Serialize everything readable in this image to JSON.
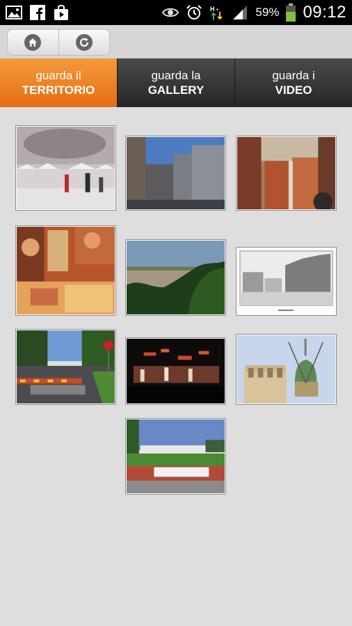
{
  "status_bar": {
    "battery_percent": "59%",
    "time": "09:12",
    "left_icons": [
      "gallery-icon",
      "facebook-icon",
      "shopping-bag-icon"
    ],
    "right_icons": [
      "eye-icon",
      "alarm-icon",
      "data-transfer-icon",
      "signal-icon",
      "battery-icon"
    ]
  },
  "nav": {
    "buttons": [
      "home-icon",
      "refresh-icon"
    ]
  },
  "tabs": [
    {
      "line1": "guarda il",
      "line2": "TERRITORIO",
      "active": true
    },
    {
      "line1": "guarda la",
      "line2": "GALLERY",
      "active": false
    },
    {
      "line1": "guarda i",
      "line2": "VIDEO",
      "active": false
    }
  ],
  "gallery": {
    "photos": [
      {
        "subject": "foggy square ice rink"
      },
      {
        "subject": "street buildings blue sky"
      },
      {
        "subject": "aerial town rooftops"
      },
      {
        "subject": "market stall food"
      },
      {
        "subject": "river landscape"
      },
      {
        "subject": "historic engraving square"
      },
      {
        "subject": "street with stop marking"
      },
      {
        "subject": "night concert stage"
      },
      {
        "subject": "bell towers sky"
      },
      {
        "subject": "sports field stadium"
      }
    ]
  },
  "colors": {
    "accent": "#f08a2c",
    "tab_dark": "#333333",
    "background": "#dedede"
  }
}
